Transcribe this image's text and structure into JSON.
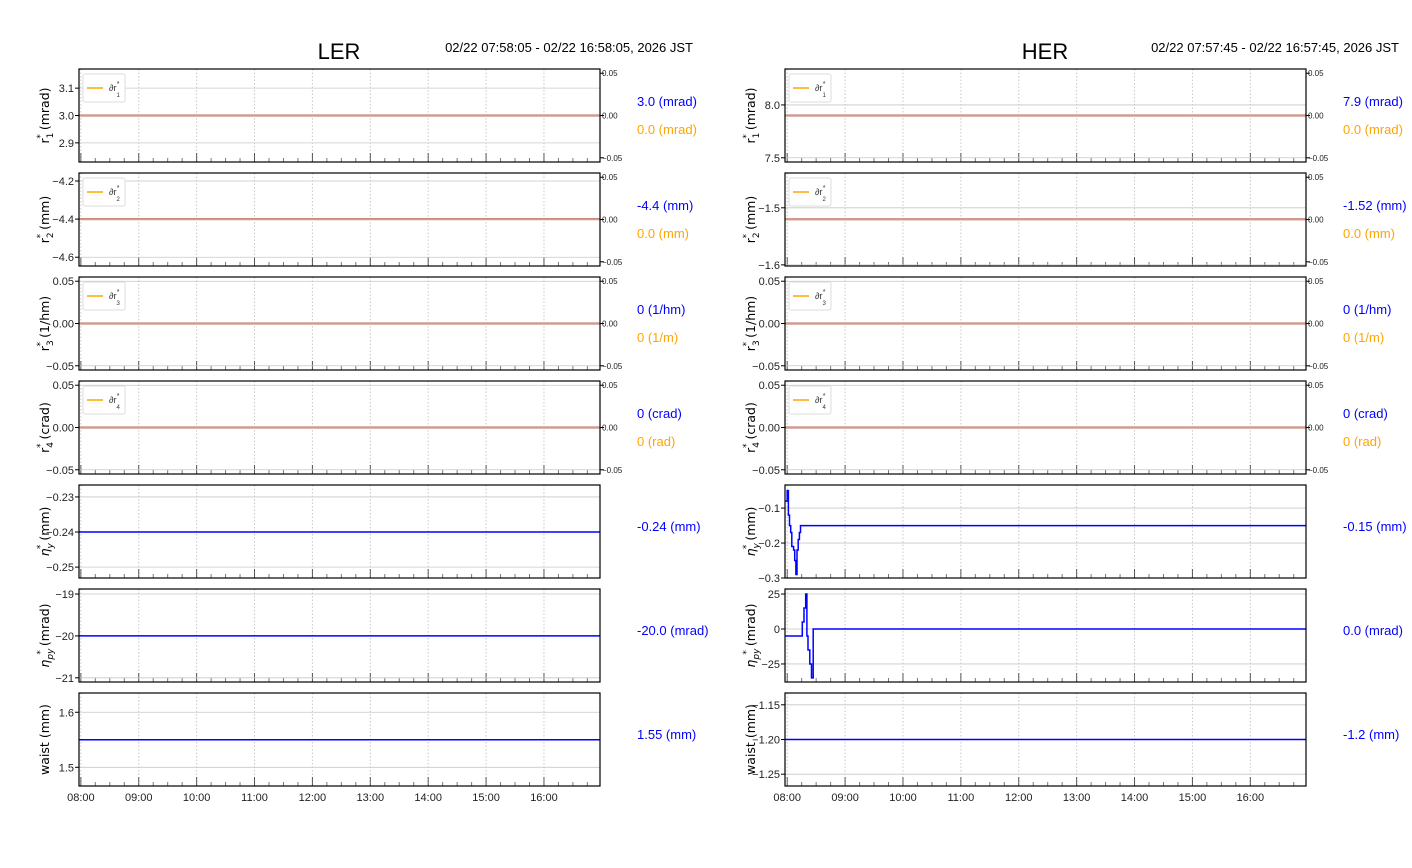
{
  "colors": {
    "blue": "#0000ff",
    "orange": "#ffa500",
    "ref": "#c88a7a",
    "grid": "#c8c8c8"
  },
  "chart_data": [
    {
      "panel": "LER",
      "title": "LER",
      "range_text": "02/22 07:58:05 - 02/22 16:58:05, 2026 JST",
      "xlim": [
        7.968,
        16.968
      ],
      "xticks": [
        "08:00",
        "09:00",
        "10:00",
        "11:00",
        "12:00",
        "13:00",
        "14:00",
        "15:00",
        "16:00"
      ],
      "subplots": [
        {
          "type": "line",
          "ylabel": {
            "sym": "r",
            "sub": "1",
            "unit": "(mrad)"
          },
          "ylim": [
            2.83,
            3.17
          ],
          "yticks": [
            2.9,
            3.0,
            3.1
          ],
          "ytick_labels": [
            "2.9",
            "3.0",
            "3.1"
          ],
          "value": 3.0,
          "legend": "∂r*1",
          "right_axis": {
            "ylim": [
              -0.055,
              0.055
            ],
            "ticks": [
              "0.05",
              "0.00",
              "−0.05"
            ]
          },
          "delta": 0.0,
          "value_text": "3.0 (mrad)",
          "delta_text": "0.0 (mrad)"
        },
        {
          "type": "line",
          "ylabel": {
            "sym": "r",
            "sub": "2",
            "unit": "(mm)"
          },
          "ylim": [
            -4.646,
            -4.158
          ],
          "yticks": [
            -4.6,
            -4.4,
            -4.2
          ],
          "ytick_labels": [
            "−4.6",
            "−4.4",
            "−4.2"
          ],
          "value": -4.4,
          "legend": "∂r*2",
          "right_axis": {
            "ylim": [
              -0.055,
              0.055
            ],
            "ticks": [
              "0.05",
              "0.00",
              "−0.05"
            ]
          },
          "delta": 0.0,
          "value_text": "-4.4 (mm)",
          "delta_text": "0.0 (mm)"
        },
        {
          "type": "line",
          "ylabel": {
            "sym": "r",
            "sub": "3",
            "unit": "(1/hm)"
          },
          "ylim": [
            -0.055,
            0.055
          ],
          "yticks": [
            -0.05,
            0,
            0.05
          ],
          "ytick_labels": [
            "−0.05",
            "0.00",
            "0.05"
          ],
          "value": 0,
          "legend": "∂r*3",
          "right_axis": {
            "ylim": [
              -0.055,
              0.055
            ],
            "ticks": [
              "0.05",
              "0.00",
              "−0.05"
            ]
          },
          "delta": 0,
          "value_text": "0 (1/hm)",
          "delta_text": "0 (1/m)"
        },
        {
          "type": "line",
          "ylabel": {
            "sym": "r",
            "sub": "4",
            "unit": "(crad)"
          },
          "ylim": [
            -0.055,
            0.055
          ],
          "yticks": [
            -0.05,
            0,
            0.05
          ],
          "ytick_labels": [
            "−0.05",
            "0.00",
            "0.05"
          ],
          "value": 0,
          "legend": "∂r*4",
          "right_axis": {
            "ylim": [
              -0.055,
              0.055
            ],
            "ticks": [
              "0.05",
              "0.00",
              "−0.05"
            ]
          },
          "delta": 0,
          "value_text": "0 (crad)",
          "delta_text": "0 (rad)"
        },
        {
          "type": "line",
          "ylabel": {
            "sym": "η",
            "sub": "y",
            "unit": "(mm)"
          },
          "ylim": [
            -0.2531,
            -0.2266
          ],
          "yticks": [
            -0.25,
            -0.24,
            -0.23
          ],
          "ytick_labels": [
            "−0.25",
            "−0.24",
            "−0.23"
          ],
          "series": [
            [
              7.968,
              -0.24
            ],
            [
              16.968,
              -0.24
            ]
          ],
          "value_text": "-0.24 (mm)"
        },
        {
          "type": "line",
          "ylabel": {
            "sym": "η",
            "sub": "py",
            "unit": "(mrad)"
          },
          "ylim": [
            -21.1,
            -18.88
          ],
          "yticks": [
            -21,
            -20,
            -19
          ],
          "ytick_labels": [
            "−21",
            "−20",
            "−19"
          ],
          "series": [
            [
              7.968,
              -20
            ],
            [
              16.968,
              -20
            ]
          ],
          "value_text": "-20.0 (mrad)"
        },
        {
          "type": "line",
          "ylabel": {
            "sym": "waist",
            "sub": "",
            "unit": "(mm)"
          },
          "ylim": [
            1.466,
            1.635
          ],
          "yticks": [
            1.5,
            1.6
          ],
          "ytick_labels": [
            "1.5",
            "1.6"
          ],
          "series": [
            [
              7.968,
              1.55
            ],
            [
              16.968,
              1.55
            ]
          ],
          "value_text": "1.55 (mm)"
        }
      ]
    },
    {
      "panel": "HER",
      "title": "HER",
      "range_text": "02/22 07:57:45 - 02/22 16:57:45, 2026 JST",
      "xlim": [
        7.962,
        16.962
      ],
      "xticks": [
        "08:00",
        "09:00",
        "10:00",
        "11:00",
        "12:00",
        "13:00",
        "14:00",
        "15:00",
        "16:00"
      ],
      "subplots": [
        {
          "type": "line",
          "ylabel": {
            "sym": "r",
            "sub": "1",
            "unit": "(mrad)"
          },
          "ylim": [
            7.46,
            8.34
          ],
          "yticks": [
            7.5,
            8.0
          ],
          "ytick_labels": [
            "7.5",
            "8.0"
          ],
          "value": 7.9,
          "legend": "∂r*1",
          "right_axis": {
            "ylim": [
              -0.055,
              0.055
            ],
            "ticks": [
              "0.05",
              "0.00",
              "−0.05"
            ]
          },
          "delta": 0.0,
          "value_text": "7.9 (mrad)",
          "delta_text": "0.0 (mrad)"
        },
        {
          "type": "line",
          "ylabel": {
            "sym": "r",
            "sub": "2",
            "unit": "(mm)"
          },
          "ylim": [
            -1.602,
            -1.439
          ],
          "yticks": [
            -1.6,
            -1.5
          ],
          "ytick_labels": [
            "−1.6",
            "−1.5"
          ],
          "value": -1.52,
          "legend": "∂r*2",
          "right_axis": {
            "ylim": [
              -0.055,
              0.055
            ],
            "ticks": [
              "0.05",
              "0.00",
              "−0.05"
            ]
          },
          "delta": 0.0,
          "value_text": "-1.52 (mm)",
          "delta_text": "0.0 (mm)"
        },
        {
          "type": "line",
          "ylabel": {
            "sym": "r",
            "sub": "3",
            "unit": "(1/hm)"
          },
          "ylim": [
            -0.055,
            0.055
          ],
          "yticks": [
            -0.05,
            0,
            0.05
          ],
          "ytick_labels": [
            "−0.05",
            "0.00",
            "0.05"
          ],
          "value": 0,
          "legend": "∂r*3",
          "right_axis": {
            "ylim": [
              -0.055,
              0.055
            ],
            "ticks": [
              "0.05",
              "0.00",
              "−0.05"
            ]
          },
          "delta": 0,
          "value_text": "0 (1/hm)",
          "delta_text": "0 (1/m)"
        },
        {
          "type": "line",
          "ylabel": {
            "sym": "r",
            "sub": "4",
            "unit": "(crad)"
          },
          "ylim": [
            -0.055,
            0.055
          ],
          "yticks": [
            -0.05,
            0,
            0.05
          ],
          "ytick_labels": [
            "−0.05",
            "0.00",
            "0.05"
          ],
          "value": 0,
          "legend": "∂r*4",
          "right_axis": {
            "ylim": [
              -0.055,
              0.055
            ],
            "ticks": [
              "0.05",
              "0.00",
              "−0.05"
            ]
          },
          "delta": 0,
          "value_text": "0 (crad)",
          "delta_text": "0 (rad)"
        },
        {
          "type": "line",
          "ylabel": {
            "sym": "η",
            "sub": "y",
            "unit": "(mm)"
          },
          "ylim": [
            -0.3,
            -0.034
          ],
          "yticks": [
            -0.3,
            -0.2,
            -0.1
          ],
          "ytick_labels": [
            "−0.3",
            "−0.2",
            "−0.1"
          ],
          "series": [
            [
              7.962,
              -0.08
            ],
            [
              8.0,
              -0.08
            ],
            [
              8.0,
              -0.05
            ],
            [
              8.02,
              -0.05
            ],
            [
              8.02,
              -0.12
            ],
            [
              8.04,
              -0.12
            ],
            [
              8.04,
              -0.15
            ],
            [
              8.06,
              -0.15
            ],
            [
              8.06,
              -0.17
            ],
            [
              8.08,
              -0.17
            ],
            [
              8.08,
              -0.21
            ],
            [
              8.11,
              -0.21
            ],
            [
              8.11,
              -0.22
            ],
            [
              8.13,
              -0.22
            ],
            [
              8.13,
              -0.25
            ],
            [
              8.15,
              -0.25
            ],
            [
              8.15,
              -0.29
            ],
            [
              8.17,
              -0.29
            ],
            [
              8.17,
              -0.22
            ],
            [
              8.19,
              -0.22
            ],
            [
              8.19,
              -0.19
            ],
            [
              8.21,
              -0.19
            ],
            [
              8.21,
              -0.17
            ],
            [
              8.23,
              -0.17
            ],
            [
              8.23,
              -0.15
            ],
            [
              16.962,
              -0.15
            ]
          ],
          "value_text": "-0.15 (mm)"
        },
        {
          "type": "line",
          "ylabel": {
            "sym": "η",
            "sub": "py",
            "unit": "(mrad)"
          },
          "ylim": [
            -37.9,
            28.6
          ],
          "yticks": [
            -25,
            0,
            25
          ],
          "ytick_labels": [
            "−25",
            "0",
            "25"
          ],
          "series": [
            [
              7.962,
              -5
            ],
            [
              8.26,
              -5
            ],
            [
              8.26,
              5
            ],
            [
              8.29,
              5
            ],
            [
              8.29,
              15
            ],
            [
              8.32,
              15
            ],
            [
              8.32,
              25
            ],
            [
              8.34,
              25
            ],
            [
              8.34,
              -5
            ],
            [
              8.36,
              -5
            ],
            [
              8.36,
              -15
            ],
            [
              8.39,
              -15
            ],
            [
              8.39,
              -25
            ],
            [
              8.42,
              -25
            ],
            [
              8.42,
              -35
            ],
            [
              8.45,
              -35
            ],
            [
              8.45,
              0
            ],
            [
              16.962,
              0
            ]
          ],
          "value_text": "0.0 (mrad)"
        },
        {
          "type": "line",
          "ylabel": {
            "sym": "waist",
            "sub": "",
            "unit": "(mm)"
          },
          "ylim": [
            -1.267,
            -1.133
          ],
          "yticks": [
            -1.25,
            -1.2,
            -1.15
          ],
          "ytick_labels": [
            "−1.25",
            "−1.20",
            "−1.15"
          ],
          "series": [
            [
              7.962,
              -1.2
            ],
            [
              16.962,
              -1.2
            ]
          ],
          "value_text": "-1.2 (mm)"
        }
      ]
    }
  ]
}
